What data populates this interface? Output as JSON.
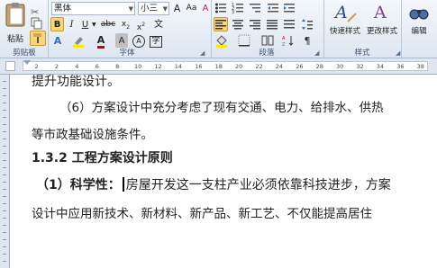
{
  "ribbon": {
    "paste_label": "粘贴",
    "cut_icon": "scissors-icon",
    "font_name": "黑体",
    "font_size": "小三",
    "bold": "B",
    "italic": "I",
    "underline": "U",
    "strikethrough": "abc",
    "font_color_letter": "A",
    "clear_format_letter": "A",
    "phonetic_letter": "文",
    "char_border_letter": "A",
    "enclosed_char": "字",
    "quick_styles_label": "快速样式",
    "change_styles_label": "更改样式",
    "editing_label": "编辑",
    "groups": {
      "clipboard": "剪贴板",
      "font": "字体",
      "paragraph": "段落",
      "styles": "样式"
    }
  },
  "ruler_numbers": [
    "2",
    "2",
    "4",
    "6",
    "8",
    "10",
    "12",
    "14",
    "16",
    "18",
    "20",
    "22",
    "24",
    "26",
    "28",
    "30",
    "32",
    "34",
    "36",
    "38"
  ],
  "document": {
    "lines": [
      "提升功能设计。",
      "（6）方案设计中充分考虑了现有交通、电力、给排水、供热",
      "等市政基础设施条件。",
      "1.3.2 工程方案设计原则",
      "（1）科学性：",
      "房屋开发这一支柱产业必须依靠科技进步，方案",
      "设计中应用新技术、新材料、新产品、新工艺、不仅能提高居住"
    ]
  }
}
